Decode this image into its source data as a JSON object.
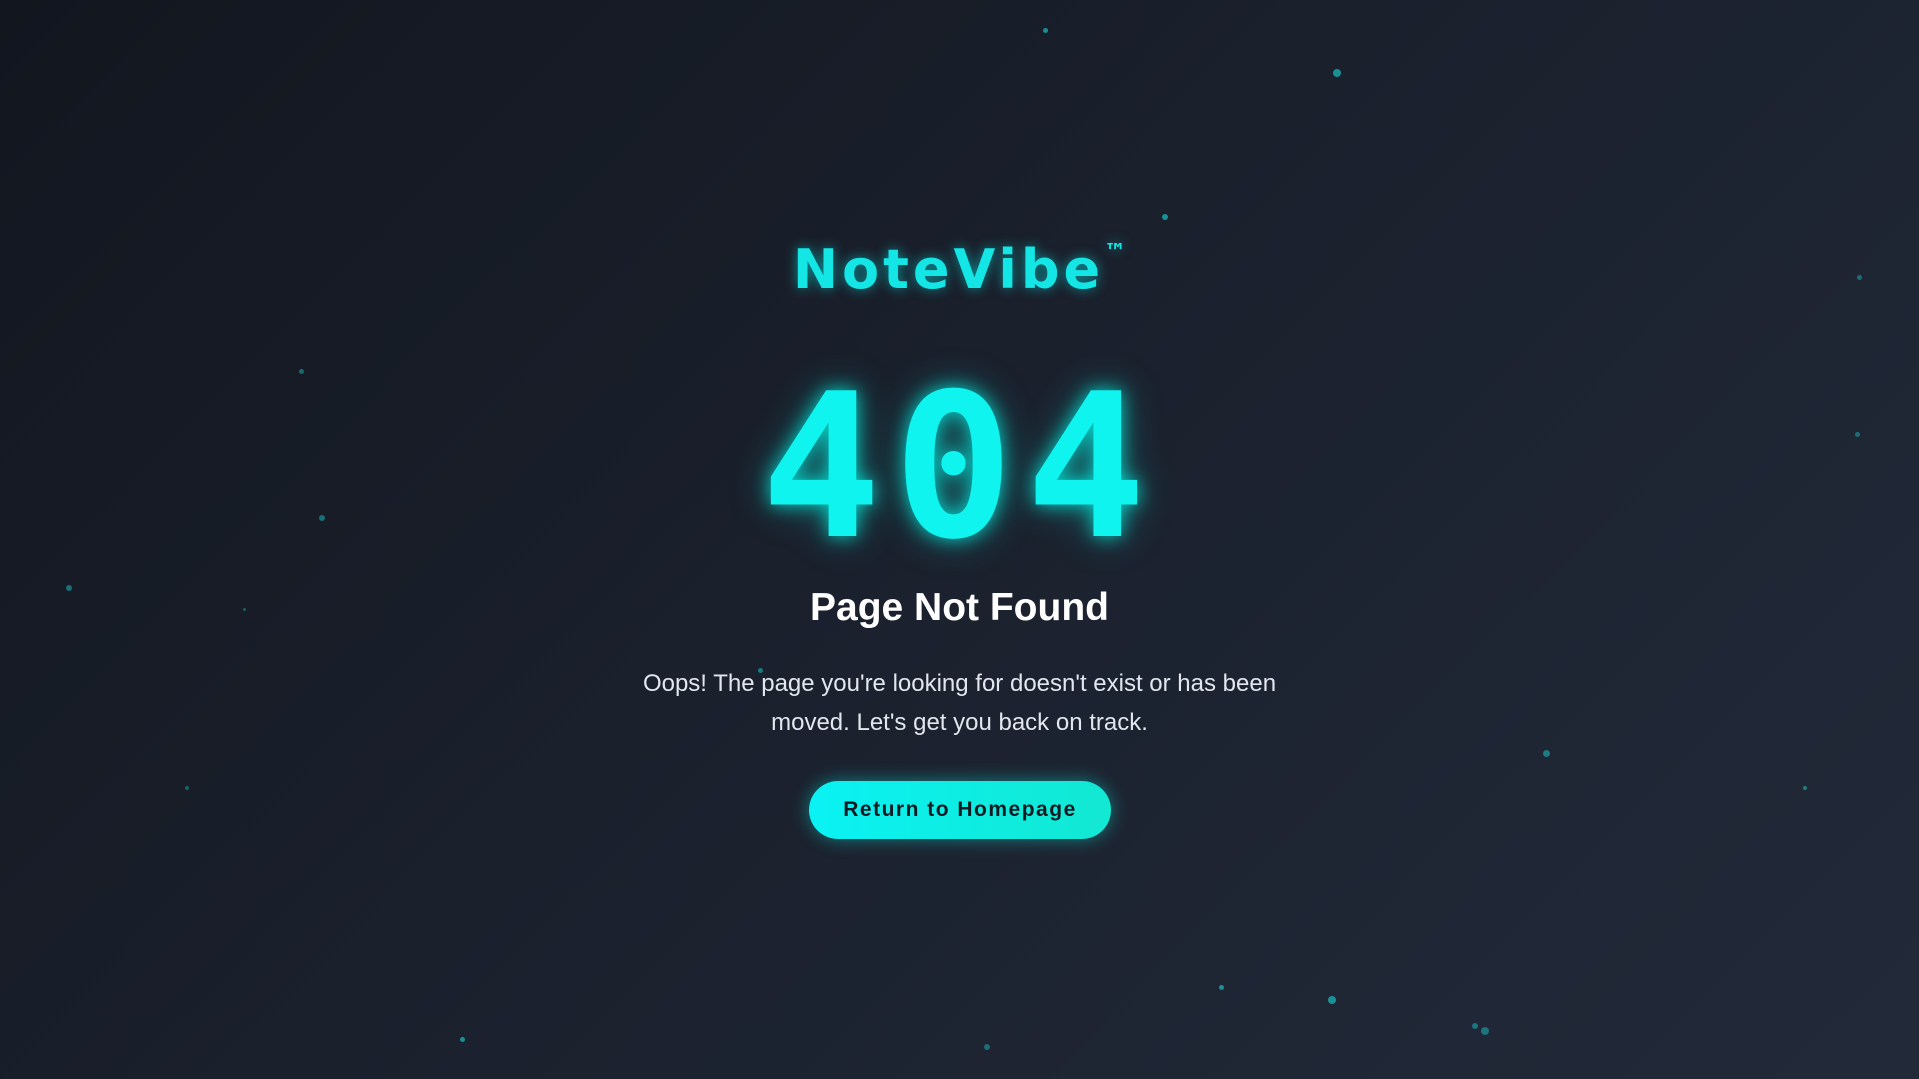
{
  "brand": {
    "name": "NoteVibe",
    "trademark": "™",
    "accent_color": "#14e6e6"
  },
  "error": {
    "code": "404",
    "title": "Page Not Found",
    "message": "Oops! The page you're looking for doesn't exist or has been moved. Let's get you back on track."
  },
  "actions": {
    "home_label": "Return to Homepage"
  },
  "colors": {
    "background_start": "#12161f",
    "background_end": "#222a3a",
    "glow": "#10f4f0",
    "button": "#0af2f4"
  }
}
